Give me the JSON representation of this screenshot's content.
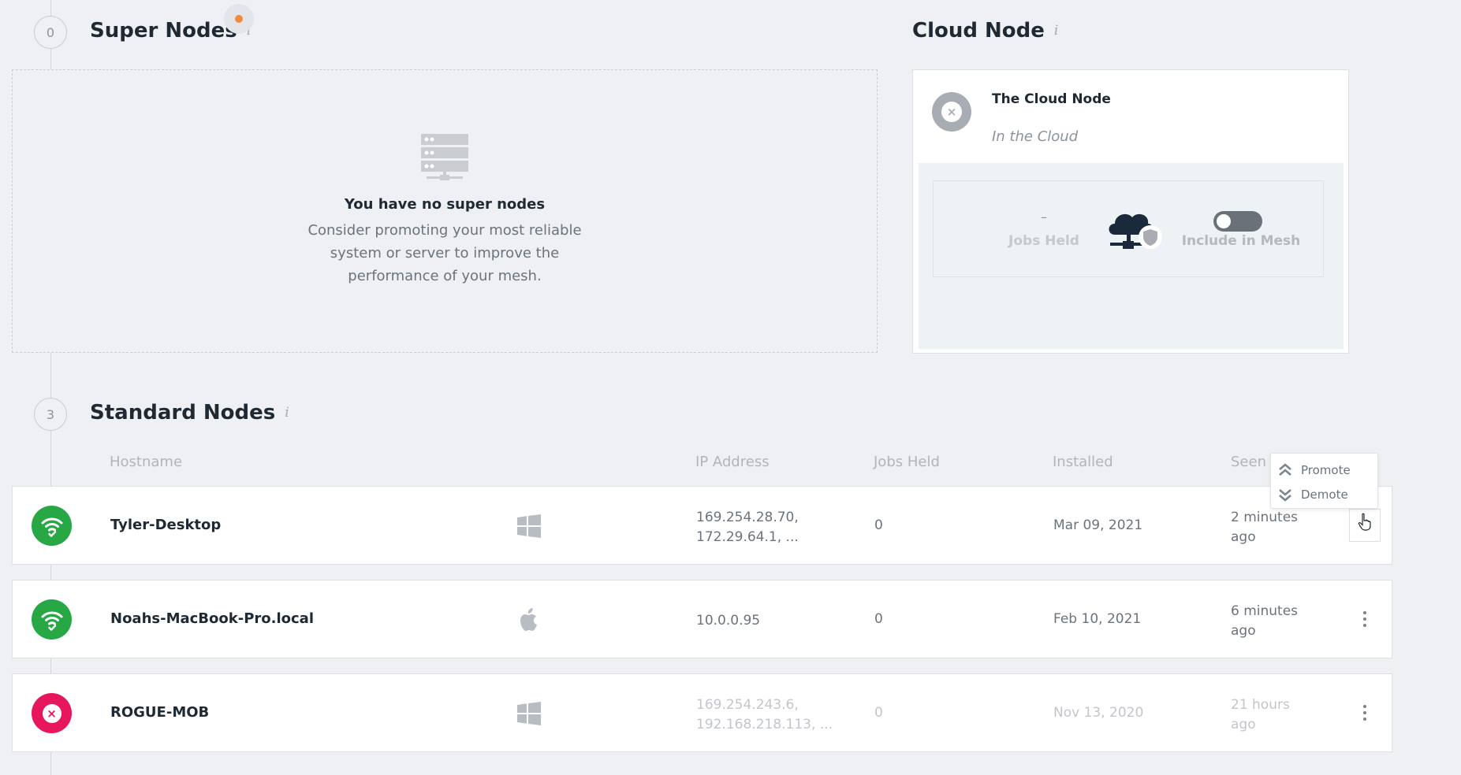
{
  "super_nodes": {
    "count": "0",
    "title": "Super Nodes",
    "info": "i",
    "empty_title": "You have no super nodes",
    "empty_body": "Consider promoting your most reliable system or server to improve the performance of your mesh."
  },
  "cloud_node": {
    "title": "Cloud Node",
    "info": "i",
    "name": "The Cloud Node",
    "subtitle": "In the Cloud",
    "jobs_held_value": "–",
    "jobs_held_label": "Jobs Held",
    "include_label": "Include in Mesh",
    "include_enabled": false
  },
  "standard_nodes": {
    "count": "3",
    "title": "Standard Nodes",
    "info": "i",
    "columns": {
      "hostname": "Hostname",
      "ip": "IP Address",
      "jobs": "Jobs Held",
      "installed": "Installed",
      "seen": "Seen"
    },
    "rows": [
      {
        "status": "online",
        "hostname": "Tyler-Desktop",
        "os": "windows-icon",
        "ip_line1": "169.254.28.70,",
        "ip_line2": "172.29.64.1, ...",
        "jobs": "0",
        "installed": "Mar 09, 2021",
        "seen_line1": "2 minutes",
        "seen_line2": "ago"
      },
      {
        "status": "online",
        "hostname": "Noahs-MacBook-Pro.local",
        "os": "apple-icon",
        "ip_line1": "10.0.0.95",
        "ip_line2": "",
        "jobs": "0",
        "installed": "Feb 10, 2021",
        "seen_line1": "6 minutes",
        "seen_line2": "ago"
      },
      {
        "status": "offline",
        "hostname": "ROGUE-MOB",
        "os": "windows-icon",
        "ip_line1": "169.254.243.6,",
        "ip_line2": "192.168.218.113, ...",
        "jobs": "0",
        "installed": "Nov 13, 2020",
        "seen_line1": "21 hours",
        "seen_line2": "ago"
      }
    ]
  },
  "context_menu": {
    "promote": "Promote",
    "demote": "Demote"
  },
  "colors": {
    "online": "#27a844",
    "offline": "#e8175d",
    "notification": "#f08a3c"
  }
}
